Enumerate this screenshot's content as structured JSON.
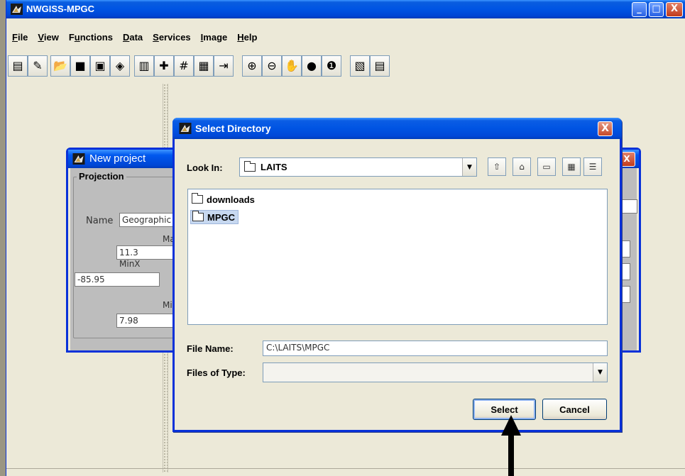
{
  "main_window": {
    "title": "NWGISS-MPGC",
    "controls": {
      "minimize": "_",
      "maximize": "□",
      "close": "X"
    }
  },
  "menubar": {
    "items": [
      {
        "pre": "",
        "u": "F",
        "post": "ile"
      },
      {
        "pre": "",
        "u": "V",
        "post": "iew"
      },
      {
        "pre": "F",
        "u": "u",
        "post": "nctions"
      },
      {
        "pre": "",
        "u": "D",
        "post": "ata"
      },
      {
        "pre": "",
        "u": "S",
        "post": "ervices"
      },
      {
        "pre": "",
        "u": "I",
        "post": "mage"
      },
      {
        "pre": "",
        "u": "H",
        "post": "elp"
      }
    ]
  },
  "toolbar": {
    "buttons": [
      {
        "name": "new-project-icon",
        "glyph": "▤"
      },
      {
        "name": "open-project-icon",
        "glyph": "✎"
      },
      {
        "name": "open-folder-icon",
        "glyph": "📂"
      },
      {
        "name": "save-icon",
        "glyph": "■"
      },
      {
        "name": "save-all-icon",
        "glyph": "▣"
      },
      {
        "name": "eraser-icon",
        "glyph": "◈"
      },
      {
        "name": "notepad-icon",
        "glyph": "▥"
      },
      {
        "name": "add-layer-icon",
        "glyph": "✚"
      },
      {
        "name": "crop-icon",
        "glyph": "#"
      },
      {
        "name": "grid-icon",
        "glyph": "▦"
      },
      {
        "name": "export-icon",
        "glyph": "⇥"
      },
      {
        "name": "zoom-in-icon",
        "glyph": "⊕"
      },
      {
        "name": "zoom-out-icon",
        "glyph": "⊖"
      },
      {
        "name": "pan-hand-icon",
        "glyph": "✋"
      },
      {
        "name": "globe-icon",
        "glyph": "●"
      },
      {
        "name": "info-icon",
        "glyph": "❶"
      },
      {
        "name": "layers-icon",
        "glyph": "▧"
      },
      {
        "name": "document-icon",
        "glyph": "▤"
      }
    ]
  },
  "new_project": {
    "title": "New project",
    "close": "X",
    "group_title": "Projection",
    "name_label": "Name",
    "name_value": "Geographic",
    "maxy_label": "Ma",
    "maxy_value": "11.3",
    "minx_label": "MinX",
    "minx_value": "-85.95",
    "miny_label": "Mi",
    "miny_value": "7.98"
  },
  "select_directory": {
    "title": "Select Directory",
    "close": "X",
    "look_in_label": "Look In:",
    "look_in_value": "LAITS",
    "folders": [
      "downloads",
      "MPGC"
    ],
    "selected_folder": "MPGC",
    "file_name_label": "File Name:",
    "file_name_value": "C:\\LAITS\\MPGC",
    "files_of_type_label": "Files of Type:",
    "files_of_type_value": "",
    "select_label": "Select",
    "cancel_label": "Cancel",
    "tools": [
      {
        "name": "up-one-level-icon",
        "glyph": "⇧"
      },
      {
        "name": "home-icon",
        "glyph": "⌂"
      },
      {
        "name": "new-folder-icon",
        "glyph": "▭"
      },
      {
        "name": "list-view-icon",
        "glyph": "▦"
      },
      {
        "name": "details-view-icon",
        "glyph": "☰"
      }
    ]
  },
  "colors": {
    "xp_blue": "#0054e3",
    "dialog_bg": "#ece9d8",
    "close_red": "#c13b1b",
    "selection": "#c7d8f0"
  }
}
